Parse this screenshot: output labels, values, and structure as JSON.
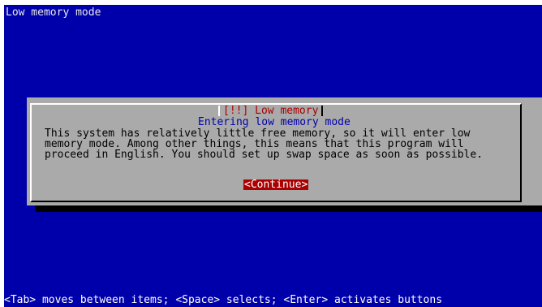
{
  "colors": {
    "screen_background": "#0000aa",
    "dialog_background": "#aaaaaa",
    "title_text": "#aa0000",
    "subtitle_text": "#0000aa",
    "button_background": "#aa0000",
    "button_text": "#ffffff"
  },
  "screen": {
    "title": "Low memory mode"
  },
  "dialog": {
    "title": "[!!] Low memory",
    "subtitle": "Entering low memory mode",
    "body_lines": [
      "This system has relatively little free memory, so it will enter low",
      "memory mode. Among other things, this means that this program will",
      "proceed in English. You should set up swap space as soon as possible."
    ],
    "continue_label": "<Continue>"
  },
  "status_bar": {
    "help_text": "<Tab> moves between items; <Space> selects; <Enter> activates buttons"
  }
}
